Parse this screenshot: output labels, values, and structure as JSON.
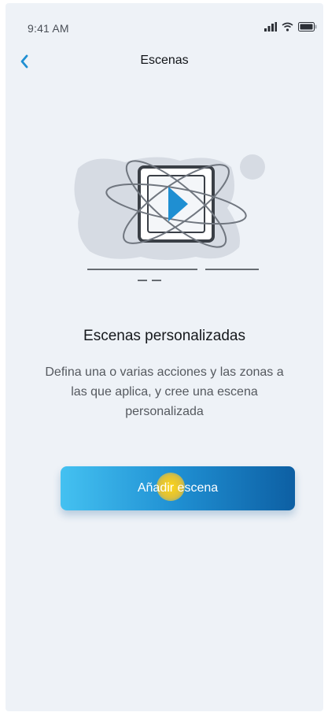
{
  "status_bar": {
    "time": "9:41 AM",
    "icons": [
      "signal-icon",
      "wifi-icon",
      "battery-icon"
    ]
  },
  "nav": {
    "back_icon": "chevron-left-icon",
    "title": "Escenas"
  },
  "illustration": {
    "icon": "play-scene-icon"
  },
  "content": {
    "heading": "Escenas personalizadas",
    "description": "Defina una o varias acciones y las zonas a las que aplica, y cree una escena personalizada"
  },
  "actions": {
    "add_scene_label": "Añadir escena"
  },
  "colors": {
    "accent": "#1f8fd2",
    "background": "#eef2f7",
    "button_gradient_start": "#44c1f1",
    "button_gradient_end": "#0d5fa3"
  }
}
